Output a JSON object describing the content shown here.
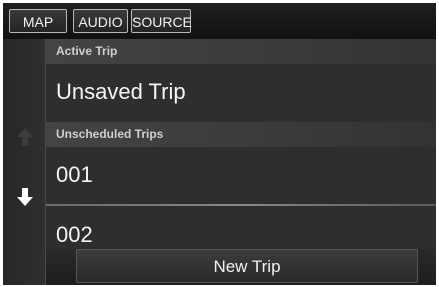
{
  "tabs": {
    "map": "MAP",
    "audio": "AUDIO",
    "source": "SOURCE"
  },
  "list": {
    "active_header": "Active Trip",
    "active_item": "Unsaved Trip",
    "unscheduled_header": "Unscheduled Trips",
    "items": [
      "001",
      "002"
    ]
  },
  "scroll": {
    "up_icon": "arrow-up-icon",
    "down_icon": "arrow-down-icon",
    "up_enabled": false,
    "down_enabled": true
  },
  "actions": {
    "new_trip": "New Trip"
  },
  "colors": {
    "background": "#2e2e2e",
    "text": "#f4f4f4",
    "header_text": "#cfcfcf"
  }
}
